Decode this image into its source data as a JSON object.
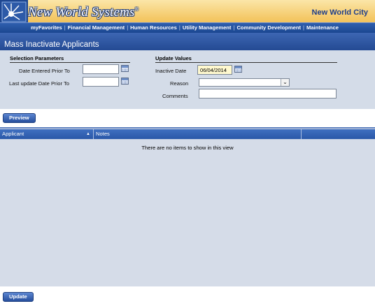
{
  "header": {
    "brand": "New World Systems",
    "brand_mark": "®",
    "org": "New World City"
  },
  "nav": {
    "items": [
      "myFavorites",
      "Financial Management",
      "Human Resources",
      "Utility Management",
      "Community Development",
      "Maintenance"
    ],
    "separator": "|"
  },
  "page": {
    "title": "Mass Inactivate Applicants"
  },
  "selection": {
    "heading": "Selection Parameters",
    "date_entered_label": "Date Entered Prior To",
    "date_entered_value": "",
    "last_update_label": "Last update Date Prior To",
    "last_update_value": ""
  },
  "update": {
    "heading": "Update Values",
    "inactive_date_label": "Inactive Date",
    "inactive_date_value": "06/04/2014",
    "reason_label": "Reason",
    "reason_value": "",
    "comments_label": "Comments",
    "comments_value": ""
  },
  "buttons": {
    "preview": "Preview",
    "update": "Update"
  },
  "grid": {
    "columns": [
      "Applicant",
      "Notes"
    ],
    "sort_indicator": "▲",
    "empty_message": "There are no items to show in this view"
  },
  "colors": {
    "header_gold": "#f4c866",
    "nav_blue": "#1b4791",
    "panel_gray": "#d4dce8",
    "grid_header_blue": "#2a58a8",
    "date_highlight": "#fff9cf"
  }
}
